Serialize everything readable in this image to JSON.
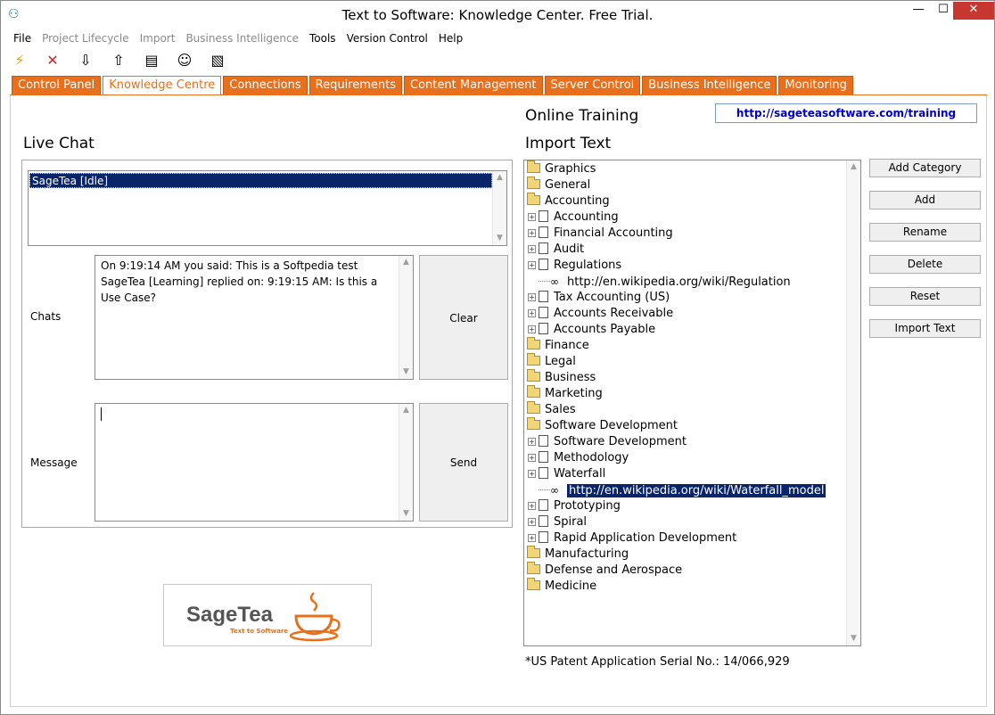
{
  "window": {
    "title": "Text to Software: Knowledge Center. Free Trial."
  },
  "menu": [
    "File",
    "Project Lifecycle",
    "Import",
    "Business Intelligence",
    "Tools",
    "Version Control",
    "Help"
  ],
  "menu_disabled": [
    false,
    true,
    true,
    true,
    false,
    false,
    false
  ],
  "toolbar_icons": [
    "lightning-icon",
    "delete-icon",
    "down-arrow-icon",
    "up-arrow-icon",
    "list-icon",
    "users-icon",
    "book-icon"
  ],
  "tabs": [
    "Control Panel",
    "Knowledge Centre",
    "Connections",
    "Requirements",
    "Content Management",
    "Server Control",
    "Business Intelligence",
    "Monitoring"
  ],
  "active_tab": 1,
  "live_chat": {
    "title": "Live Chat",
    "users": [
      "SageTea [Idle]"
    ],
    "chats_label": "Chats",
    "message_label": "Message",
    "chat_log": "On 9:19:14 AM you said: This is a Softpedia test\nSageTea [Learning] replied on: 9:19:15 AM: Is this a Use Case?",
    "message_value": "",
    "clear_label": "Clear",
    "send_label": "Send"
  },
  "logo": {
    "name": "SageTea",
    "tagline": "Text to Software"
  },
  "online_training": {
    "title": "Online Training",
    "url": "http://sageteasoftware.com/training"
  },
  "import_text": {
    "title": "Import Text",
    "tree": [
      {
        "label": "Graphics",
        "type": "folder",
        "level": 0
      },
      {
        "label": "General",
        "type": "folder",
        "level": 0
      },
      {
        "label": "Accounting",
        "type": "folder",
        "level": 0
      },
      {
        "label": "Accounting",
        "type": "doc",
        "level": 1
      },
      {
        "label": "Financial Accounting",
        "type": "doc",
        "level": 1
      },
      {
        "label": "Audit",
        "type": "doc",
        "level": 1
      },
      {
        "label": "Regulations",
        "type": "doc",
        "level": 1
      },
      {
        "label": "http://en.wikipedia.org/wiki/Regulation",
        "type": "link",
        "level": 2
      },
      {
        "label": "Tax Accounting (US)",
        "type": "doc",
        "level": 1
      },
      {
        "label": "Accounts Receivable",
        "type": "doc",
        "level": 1
      },
      {
        "label": "Accounts Payable",
        "type": "doc",
        "level": 1
      },
      {
        "label": "Finance",
        "type": "folder",
        "level": 0
      },
      {
        "label": "Legal",
        "type": "folder",
        "level": 0
      },
      {
        "label": "Business",
        "type": "folder",
        "level": 0
      },
      {
        "label": "Marketing",
        "type": "folder",
        "level": 0
      },
      {
        "label": "Sales",
        "type": "folder",
        "level": 0
      },
      {
        "label": "Software Development",
        "type": "folder",
        "level": 0
      },
      {
        "label": "Software Development",
        "type": "doc",
        "level": 1
      },
      {
        "label": "Methodology",
        "type": "doc",
        "level": 1
      },
      {
        "label": "Waterfall",
        "type": "doc",
        "level": 1
      },
      {
        "label": "http://en.wikipedia.org/wiki/Waterfall_model",
        "type": "link",
        "level": 2,
        "selected": true
      },
      {
        "label": "Prototyping",
        "type": "doc",
        "level": 1
      },
      {
        "label": "Spiral",
        "type": "doc",
        "level": 1
      },
      {
        "label": "Rapid Application Development",
        "type": "doc",
        "level": 1
      },
      {
        "label": "Manufacturing",
        "type": "folder",
        "level": 0
      },
      {
        "label": "Defense and Aerospace",
        "type": "folder",
        "level": 0
      },
      {
        "label": "Medicine",
        "type": "folder",
        "level": 0
      }
    ],
    "buttons": [
      "Add Category",
      "Add",
      "Rename",
      "Delete",
      "Reset",
      "Import Text"
    ]
  },
  "patent": "*US Patent Application Serial No.: 14/066,929",
  "colors": {
    "tab_orange": "#e8701c",
    "selection": "#0a246a",
    "link_blue": "#0000c8"
  }
}
